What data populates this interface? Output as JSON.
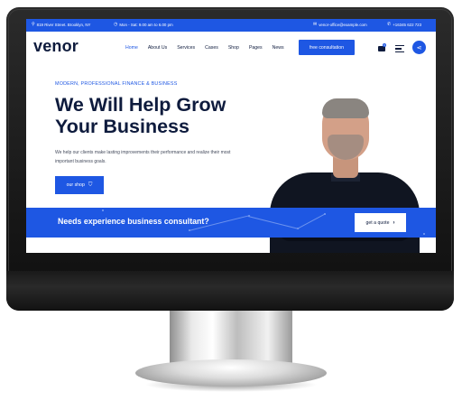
{
  "topbar": {
    "address": "819 River Street. Brooklyn, NY",
    "hours": "Mon - Sat: 9.00 am to 6.00 pm",
    "email": "venor-office@example.com",
    "phone": "+16345 622 723"
  },
  "nav": {
    "logo": "venor",
    "items": [
      "Home",
      "About Us",
      "Services",
      "Cases",
      "Shop",
      "Pages",
      "News"
    ],
    "cta": "free consultation",
    "cart_count": "0"
  },
  "hero": {
    "eyebrow": "MODERN, PROFESSIONAL FINANCE & BUSINESS",
    "headline": "We Will Help Grow Your Business",
    "description": "We help our clients make lasting improvements their performance and realize their most important business goals.",
    "button": "our shop"
  },
  "band": {
    "text": "Needs experience business consultant?",
    "button": "get a quote"
  },
  "colors": {
    "accent": "#1e57e3",
    "navy": "#0e1b3d"
  },
  "icons": [
    "phone-icon",
    "clock-icon",
    "mail-icon",
    "cart-icon",
    "menu-icon",
    "share-icon",
    "arrow-right-icon"
  ]
}
